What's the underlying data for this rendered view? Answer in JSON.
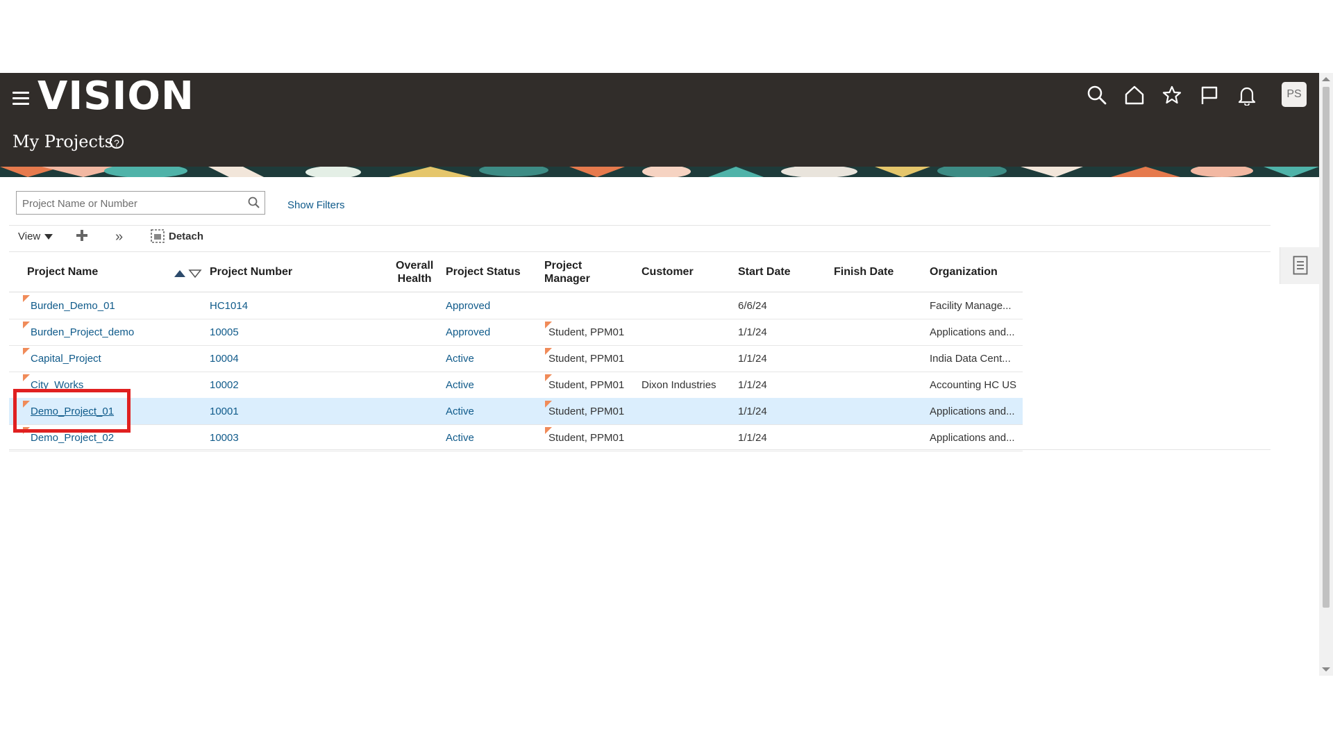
{
  "app": {
    "logo_text": "VISION",
    "page_title": "My Projects",
    "avatar_initials": "PS"
  },
  "header_icons": [
    "search-icon",
    "home-icon",
    "star-icon",
    "flag-icon",
    "bell-icon"
  ],
  "search": {
    "placeholder": "Project Name or Number",
    "value": ""
  },
  "show_filters_label": "Show Filters",
  "toolbar": {
    "view_label": "View",
    "detach_label": "Detach"
  },
  "table": {
    "headers": {
      "project_name": "Project Name",
      "project_number": "Project Number",
      "overall_health_1": "Overall",
      "overall_health_2": "Health",
      "project_status": "Project Status",
      "project_manager_1": "Project",
      "project_manager_2": "Manager",
      "customer": "Customer",
      "start_date": "Start Date",
      "finish_date": "Finish Date",
      "organization": "Organization"
    },
    "rows": [
      {
        "name": "Burden_Demo_01",
        "number": "HC1014",
        "health": "",
        "status": "Approved",
        "manager": "",
        "customer": "",
        "start": "6/6/24",
        "finish": "",
        "org": "Facility Manage..."
      },
      {
        "name": "Burden_Project_demo",
        "number": "10005",
        "health": "",
        "status": "Approved",
        "manager": "Student, PPM01",
        "customer": "",
        "start": "1/1/24",
        "finish": "",
        "org": "Applications and..."
      },
      {
        "name": "Capital_Project",
        "number": "10004",
        "health": "",
        "status": "Active",
        "manager": "Student, PPM01",
        "customer": "",
        "start": "1/1/24",
        "finish": "",
        "org": "India Data Cent..."
      },
      {
        "name": "City_Works",
        "number": "10002",
        "health": "",
        "status": "Active",
        "manager": "Student, PPM01",
        "customer": "Dixon Industries",
        "start": "1/1/24",
        "finish": "",
        "org": "Accounting HC US"
      },
      {
        "name": "Demo_Project_01",
        "number": "10001",
        "health": "",
        "status": "Active",
        "manager": "Student, PPM01",
        "customer": "",
        "start": "1/1/24",
        "finish": "",
        "org": "Applications and..."
      },
      {
        "name": "Demo_Project_02",
        "number": "10003",
        "health": "",
        "status": "Active",
        "manager": "Student, PPM01",
        "customer": "",
        "start": "1/1/24",
        "finish": "",
        "org": "Applications and..."
      }
    ]
  },
  "colors": {
    "header_bg": "#312d2a",
    "link": "#0f5a8a",
    "selected_row": "#dbeefd",
    "highlight_box": "#e02020",
    "flag": "#f08b59"
  }
}
